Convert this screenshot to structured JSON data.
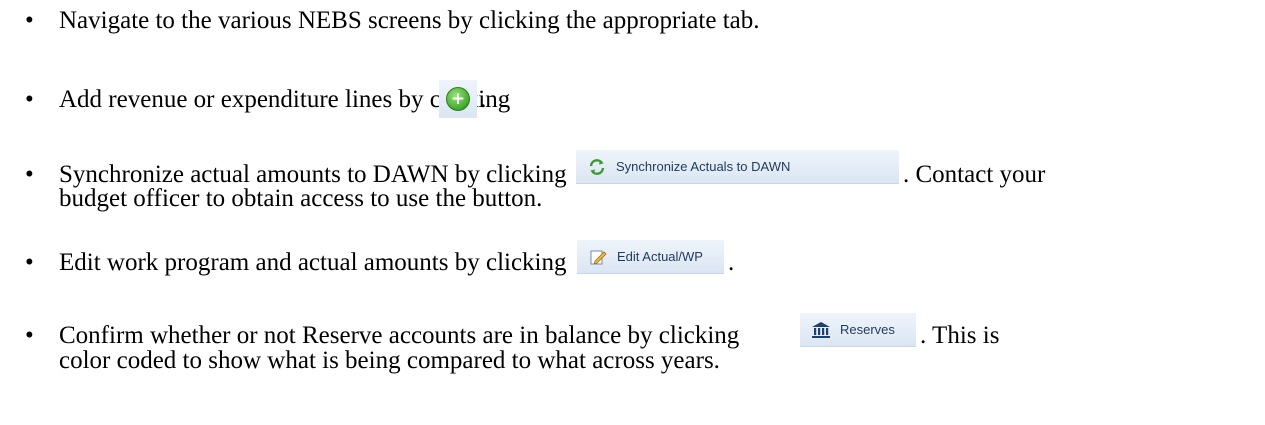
{
  "bullets": {
    "symbol": "•",
    "item1": {
      "text": "Navigate to the various NEBS screens by clicking the appropriate tab."
    },
    "item2": {
      "before": "Add revenue or expenditure lines by clicking",
      "after": "."
    },
    "item3": {
      "before": "Synchronize actual amounts to DAWN by clicking",
      "button_label": "Synchronize Actuals to DAWN",
      "after": ". Contact your",
      "line2": "budget officer to obtain access to use the button."
    },
    "item4": {
      "before": "Edit work program and actual amounts by clicking",
      "button_label": "Edit Actual/WP",
      "after": "."
    },
    "item5": {
      "before": "Confirm whether or not Reserve accounts are in balance by clicking",
      "button_label": "Reserves",
      "after": ". This is",
      "line2": "color coded to show what is being compared to what across years."
    }
  },
  "icons": {
    "add": "add-circle-icon",
    "sync": "sync-refresh-icon",
    "edit": "pencil-edit-icon",
    "reserves": "bank-building-icon"
  },
  "colors": {
    "button_bg": "#dbe6f3",
    "button_text": "#1f3a5a",
    "add_green": "#3fa92a"
  }
}
